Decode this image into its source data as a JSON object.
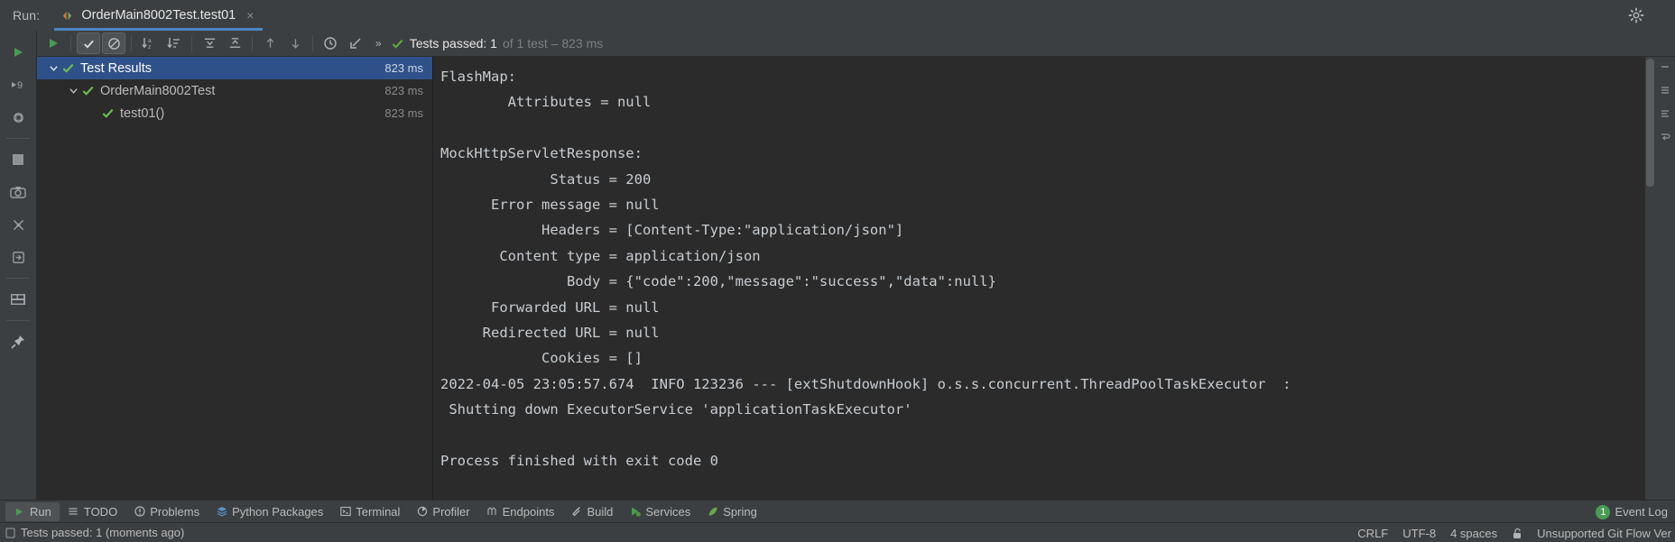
{
  "header": {
    "run_label": "Run:",
    "tab_title": "OrderMain8002Test.test01",
    "tab_icon": "run-configuration-icon",
    "close_label": "×",
    "settings_icon": "gear-icon",
    "chevron_icon": "chevron-down-icon"
  },
  "left_rail": {
    "items": [
      {
        "name": "run-icon",
        "glyph": "▶"
      },
      {
        "name": "debug-icon",
        "glyph": "9"
      },
      {
        "name": "rerun-automatically-icon",
        "glyph": "⟳"
      },
      {
        "name": "stop-icon",
        "glyph": "■"
      },
      {
        "name": "screenshot-icon",
        "glyph": "▣"
      },
      {
        "name": "mute-breakpoints-icon",
        "glyph": "✖"
      },
      {
        "name": "export-icon",
        "glyph": "⇥"
      },
      {
        "name": "layout-icon",
        "glyph": "▦"
      },
      {
        "name": "pin-tab-icon",
        "glyph": "✒"
      }
    ]
  },
  "test_toolbar": {
    "buttons": [
      {
        "name": "rerun-tests-button",
        "glyph": "▶",
        "active": false,
        "color": "#499c54"
      },
      {
        "name": "show-passed-button",
        "glyph": "✓",
        "active": true,
        "color": "#a9b7c6"
      },
      {
        "name": "show-ignored-button",
        "glyph": "⊘",
        "active": false,
        "color": "#a9b7c6"
      },
      {
        "name": "sort-alphabetically-button",
        "glyph": "↓a",
        "active": false,
        "color": "#a9b7c6"
      },
      {
        "name": "sort-by-duration-button",
        "glyph": "↓≡",
        "active": false,
        "color": "#a9b7c6"
      },
      {
        "name": "expand-all-button",
        "glyph": "⤓",
        "active": false,
        "color": "#a9b7c6"
      },
      {
        "name": "collapse-all-button",
        "glyph": "⤒",
        "active": false,
        "color": "#a9b7c6"
      },
      {
        "name": "previous-failed-test-button",
        "glyph": "↑",
        "active": false,
        "color": "#a9b7c6"
      },
      {
        "name": "next-failed-test-button",
        "glyph": "↓",
        "active": false,
        "color": "#a9b7c6"
      },
      {
        "name": "test-history-button",
        "glyph": "◷",
        "active": false,
        "color": "#a9b7c6"
      },
      {
        "name": "scroll-to-stacktrace-button",
        "glyph": "↙",
        "active": false,
        "color": "#a9b7c6"
      }
    ],
    "overflow_label": "»",
    "status": {
      "icon": "check-green-icon",
      "main_text": "Tests passed: 1",
      "dim_text": " of 1 test – 823 ms"
    }
  },
  "tree": {
    "rows": [
      {
        "label": "Test Results",
        "time": "823 ms",
        "indent": 10,
        "twisty": "⌄",
        "status_icon": "check-green-icon",
        "selected": true
      },
      {
        "label": "OrderMain8002Test",
        "time": "823 ms",
        "indent": 32,
        "twisty": "⌄",
        "status_icon": "check-green-icon",
        "selected": false
      },
      {
        "label": "test01()",
        "time": "823 ms",
        "indent": 54,
        "twisty": "",
        "status_icon": "check-green-icon",
        "selected": false
      }
    ]
  },
  "console": {
    "text": "FlashMap:\n        Attributes = null\n\nMockHttpServletResponse:\n             Status = 200\n      Error message = null\n            Headers = [Content-Type:\"application/json\"]\n       Content type = application/json\n               Body = {\"code\":200,\"message\":\"success\",\"data\":null}\n      Forwarded URL = null\n     Redirected URL = null\n            Cookies = []\n2022-04-05 23:05:57.674  INFO 123236 --- [extShutdownHook] o.s.s.concurrent.ThreadPoolTaskExecutor  :\n Shutting down ExecutorService 'applicationTaskExecutor'\n\nProcess finished with exit code 0"
  },
  "right_rail": {
    "items": [
      {
        "name": "minimize-icon",
        "glyph": "—"
      },
      {
        "name": "list-lines-icon",
        "glyph": "☰"
      },
      {
        "name": "wrap-lines-icon",
        "glyph": "≡"
      },
      {
        "name": "soft-wrap-icon",
        "glyph": "↵"
      }
    ]
  },
  "tool_bar": {
    "items": [
      {
        "label": "Run",
        "icon": "run-icon",
        "glyph": "▶",
        "color": "#499c54",
        "active": true
      },
      {
        "label": "TODO",
        "icon": "todo-list-icon",
        "glyph": "☰",
        "color": "#a9b7c6",
        "active": false
      },
      {
        "label": "Problems",
        "icon": "problems-icon",
        "glyph": "❗",
        "color": "#a9b7c6",
        "active": false
      },
      {
        "label": "Python Packages",
        "icon": "python-packages-icon",
        "glyph": "⧉",
        "color": "#6a9fd8",
        "active": false
      },
      {
        "label": "Terminal",
        "icon": "terminal-icon",
        "glyph": "⌨",
        "color": "#a9b7c6",
        "active": false
      },
      {
        "label": "Profiler",
        "icon": "profiler-icon",
        "glyph": "◔",
        "color": "#a9b7c6",
        "active": false
      },
      {
        "label": "Endpoints",
        "icon": "endpoints-icon",
        "glyph": "⑂",
        "color": "#a9b7c6",
        "active": false
      },
      {
        "label": "Build",
        "icon": "build-hammer-icon",
        "glyph": "⚒",
        "color": "#a9b7c6",
        "active": false
      },
      {
        "label": "Services",
        "icon": "services-icon",
        "glyph": "▶",
        "color": "#499c54",
        "active": false
      },
      {
        "label": "Spring",
        "icon": "spring-leaf-icon",
        "glyph": "❦",
        "color": "#6a9c3a",
        "active": false
      }
    ],
    "event_log": {
      "count": "1",
      "label": "Event Log"
    }
  },
  "status_bar": {
    "left_icon": "notification-icon",
    "left_text": "Tests passed: 1 (moments ago)",
    "right_items": [
      {
        "name": "line-separator",
        "text": "CRLF"
      },
      {
        "name": "file-encoding",
        "text": "UTF-8"
      },
      {
        "name": "indent-setting",
        "text": "4 spaces"
      },
      {
        "name": "lock-icon",
        "text": "🔓"
      },
      {
        "name": "git-flow-status",
        "text": "Unsupported Git Flow Ver"
      }
    ]
  },
  "colors": {
    "background": "#3c3f41",
    "editor_background": "#2b2b2b",
    "accent_blue": "#4a88c7",
    "selection_blue": "#2f5189",
    "success_green": "#499c54",
    "text": "#bbbbbb",
    "dim_text": "#7b7f81"
  }
}
